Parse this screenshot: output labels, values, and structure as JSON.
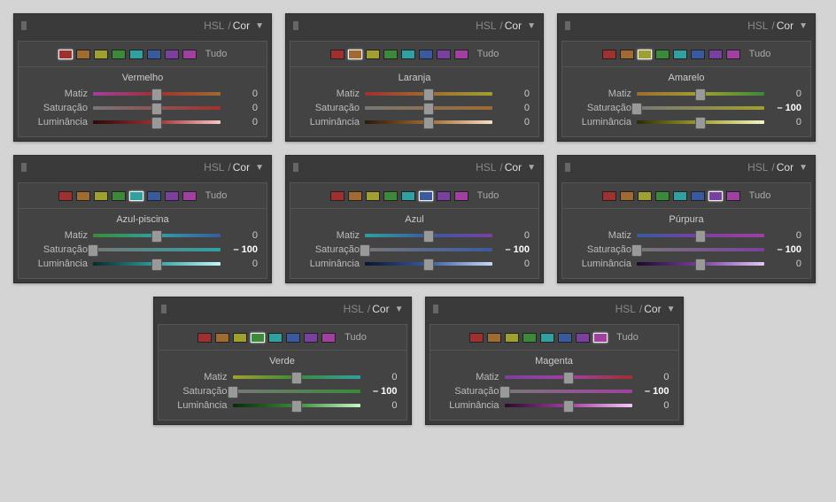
{
  "header": {
    "hsl": "HSL",
    "slash": "/",
    "cor": "Cor"
  },
  "labels": {
    "tudo": "Tudo",
    "matiz": "Matiz",
    "saturacao": "Saturação",
    "luminancia": "Luminância"
  },
  "swatch_colors": [
    "#a03030",
    "#a06a30",
    "#a0a030",
    "#3a8a3a",
    "#30a0a0",
    "#3a5aa0",
    "#7a40a0",
    "#a040a0"
  ],
  "panels": [
    {
      "id": "vermelho",
      "name": "Vermelho",
      "selected": 0,
      "hue_gradient": [
        "#a040a0",
        "#a03030",
        "#a06a30"
      ],
      "sat_gradient": [
        "#777",
        "#a03030"
      ],
      "lum_gradient": [
        "#2a0a0a",
        "#a03030",
        "#f5c8c8"
      ],
      "sliders": [
        {
          "label": "matiz",
          "value": 0,
          "pos": 50
        },
        {
          "label": "saturacao",
          "value": 0,
          "pos": 50
        },
        {
          "label": "luminancia",
          "value": 0,
          "pos": 50
        }
      ]
    },
    {
      "id": "laranja",
      "name": "Laranja",
      "selected": 1,
      "hue_gradient": [
        "#a03030",
        "#a06a30",
        "#a0a030"
      ],
      "sat_gradient": [
        "#777",
        "#a06a30"
      ],
      "lum_gradient": [
        "#2a1a0a",
        "#a06a30",
        "#f5e0c8"
      ],
      "sliders": [
        {
          "label": "matiz",
          "value": 0,
          "pos": 50
        },
        {
          "label": "saturacao",
          "value": 0,
          "pos": 50
        },
        {
          "label": "luminancia",
          "value": 0,
          "pos": 50
        }
      ]
    },
    {
      "id": "amarelo",
      "name": "Amarelo",
      "selected": 2,
      "hue_gradient": [
        "#a06a30",
        "#a0a030",
        "#3a8a3a"
      ],
      "sat_gradient": [
        "#777",
        "#a0a030"
      ],
      "lum_gradient": [
        "#2a2a0a",
        "#a0a030",
        "#f5f5c8"
      ],
      "sliders": [
        {
          "label": "matiz",
          "value": 0,
          "pos": 50
        },
        {
          "label": "saturacao",
          "value": -100,
          "pos": 0,
          "bold": true
        },
        {
          "label": "luminancia",
          "value": 0,
          "pos": 50
        }
      ]
    },
    {
      "id": "azul-piscina",
      "name": "Azul-piscina",
      "selected": 4,
      "hue_gradient": [
        "#3a8a3a",
        "#30a0a0",
        "#3a5aa0"
      ],
      "sat_gradient": [
        "#777",
        "#30a0a0"
      ],
      "lum_gradient": [
        "#0a2a2a",
        "#30a0a0",
        "#c8f5f5"
      ],
      "sliders": [
        {
          "label": "matiz",
          "value": 0,
          "pos": 50
        },
        {
          "label": "saturacao",
          "value": -100,
          "pos": 0,
          "bold": true
        },
        {
          "label": "luminancia",
          "value": 0,
          "pos": 50
        }
      ]
    },
    {
      "id": "azul",
      "name": "Azul",
      "selected": 5,
      "hue_gradient": [
        "#30a0a0",
        "#3a5aa0",
        "#7a40a0"
      ],
      "sat_gradient": [
        "#777",
        "#3a5aa0"
      ],
      "lum_gradient": [
        "#0a162a",
        "#3a5aa0",
        "#c8d8f5"
      ],
      "sliders": [
        {
          "label": "matiz",
          "value": 0,
          "pos": 50
        },
        {
          "label": "saturacao",
          "value": -100,
          "pos": 0,
          "bold": true
        },
        {
          "label": "luminancia",
          "value": 0,
          "pos": 50
        }
      ]
    },
    {
      "id": "purpura",
      "name": "Púrpura",
      "selected": 6,
      "hue_gradient": [
        "#3a5aa0",
        "#7a40a0",
        "#a040a0"
      ],
      "sat_gradient": [
        "#777",
        "#7a40a0"
      ],
      "lum_gradient": [
        "#1a0a2a",
        "#7a40a0",
        "#e0c8f5"
      ],
      "sliders": [
        {
          "label": "matiz",
          "value": 0,
          "pos": 50
        },
        {
          "label": "saturacao",
          "value": -100,
          "pos": 0,
          "bold": true
        },
        {
          "label": "luminancia",
          "value": 0,
          "pos": 50
        }
      ]
    },
    {
      "id": "verde",
      "name": "Verde",
      "selected": 3,
      "hue_gradient": [
        "#a0a030",
        "#3a8a3a",
        "#30a0a0"
      ],
      "sat_gradient": [
        "#777",
        "#3a8a3a"
      ],
      "lum_gradient": [
        "#0a2a0a",
        "#3a8a3a",
        "#c8f5c8"
      ],
      "sliders": [
        {
          "label": "matiz",
          "value": 0,
          "pos": 50
        },
        {
          "label": "saturacao",
          "value": -100,
          "pos": 0,
          "bold": true
        },
        {
          "label": "luminancia",
          "value": 0,
          "pos": 50
        }
      ]
    },
    {
      "id": "magenta",
      "name": "Magenta",
      "selected": 7,
      "hue_gradient": [
        "#7a40a0",
        "#a040a0",
        "#a03030"
      ],
      "sat_gradient": [
        "#777",
        "#a040a0"
      ],
      "lum_gradient": [
        "#2a0a2a",
        "#a040a0",
        "#f5c8f5"
      ],
      "sliders": [
        {
          "label": "matiz",
          "value": 0,
          "pos": 50
        },
        {
          "label": "saturacao",
          "value": -100,
          "pos": 0,
          "bold": true
        },
        {
          "label": "luminancia",
          "value": 0,
          "pos": 50
        }
      ]
    }
  ]
}
